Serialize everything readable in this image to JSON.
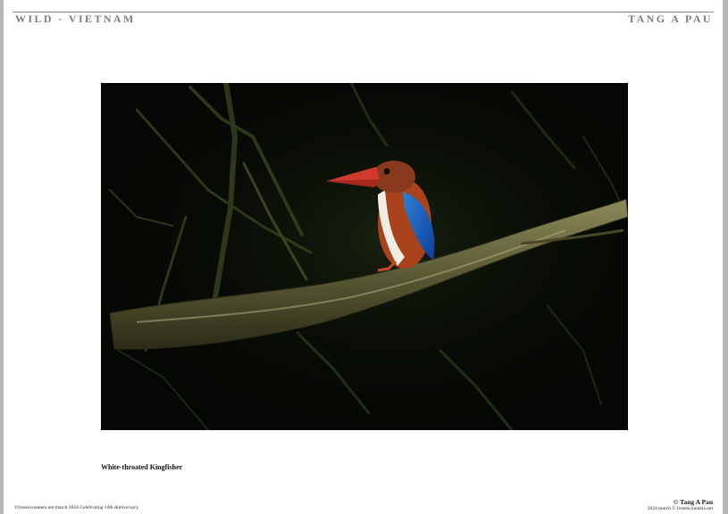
{
  "header": {
    "left": "WILD - VIETNAM",
    "right": "TANG A PAU"
  },
  "photo": {
    "subject": "kingfisher-photo"
  },
  "caption": "White-throated Kingfisher",
  "footer": {
    "left_plain": "©liveencounters.net march 2024 ",
    "left_italic": "Celebrating 14th Anniversary",
    "right_author": "© Tang A Pau",
    "right_credit": "2024 march © liveencounters.net"
  },
  "colors": {
    "header_text": "#7d7d7d",
    "photo_background": "#050704",
    "page": "#ffffff",
    "margin": "#b7b7b7"
  }
}
